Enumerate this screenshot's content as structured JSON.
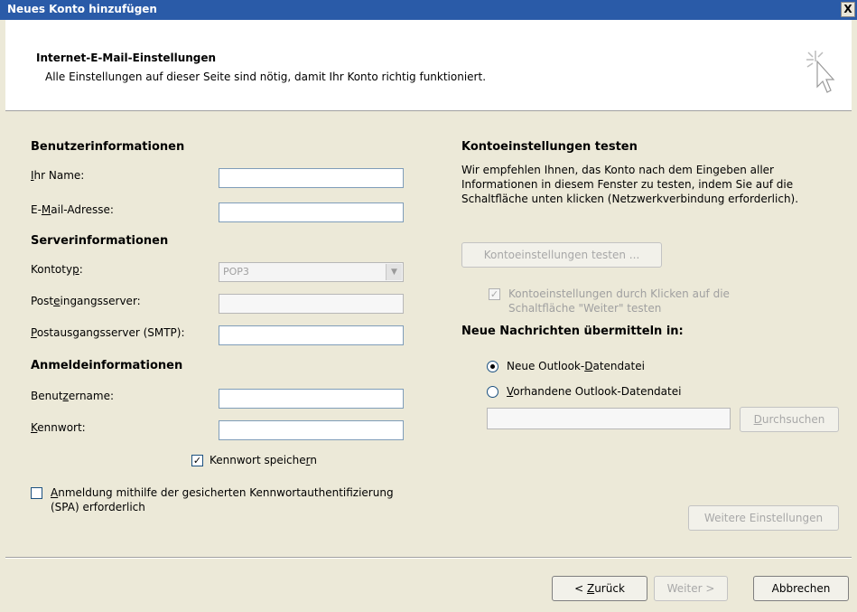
{
  "window": {
    "title": "Neues Konto hinzufügen",
    "close_glyph": "X"
  },
  "header": {
    "title": "Internet-E-Mail-Einstellungen",
    "subtitle": "Alle Einstellungen auf dieser Seite sind nötig, damit Ihr Konto richtig funktioniert.",
    "icon": "cursor-sparkle-icon"
  },
  "user_info": {
    "heading": "Benutzerinformationen",
    "name_label": "Ihr Name:",
    "name_value": "",
    "email_label": "E-Mail-Adresse:",
    "email_value": ""
  },
  "server_info": {
    "heading": "Serverinformationen",
    "account_type_label": "Kontotyp:",
    "account_type_value": "POP3",
    "incoming_label": "Posteingangsserver:",
    "incoming_value": "",
    "outgoing_label": "Postausgangsserver (SMTP):",
    "outgoing_value": ""
  },
  "login_info": {
    "heading": "Anmeldeinformationen",
    "username_label": "Benutzername:",
    "username_value": "",
    "password_label": "Kennwort:",
    "password_value": "",
    "save_password_label": "Kennwort speichern",
    "save_password_checked": true,
    "spa_label_line1": "Anmeldung mithilfe der gesicherten Kennwortauthentifizierung",
    "spa_label_line2": "(SPA) erforderlich",
    "spa_checked": false
  },
  "test": {
    "heading": "Kontoeinstellungen testen",
    "desc_line1": "Wir empfehlen Ihnen, das Konto nach dem Eingeben aller",
    "desc_line2": "Informationen in diesem Fenster zu testen, indem Sie auf die",
    "desc_line3": "Schaltfläche unten klicken (Netzwerkverbindung erforderlich).",
    "test_button": "Kontoeinstellungen testen ...",
    "auto_test_line1": "Kontoeinstellungen durch Klicken auf die",
    "auto_test_line2": "Schaltfläche \"Weiter\" testen",
    "auto_test_checked": true
  },
  "deliver": {
    "heading": "Neue Nachrichten übermitteln in:",
    "option_new": "Neue Outlook-Datendatei",
    "option_existing": "Vorhandene Outlook-Datendatei",
    "selected": "new",
    "existing_path": "",
    "browse_button": "Durchsuchen"
  },
  "more_settings_button": "Weitere Einstellungen",
  "footer": {
    "back_button": "< Zurück",
    "next_button": "Weiter >",
    "cancel_button": "Abbrechen"
  }
}
